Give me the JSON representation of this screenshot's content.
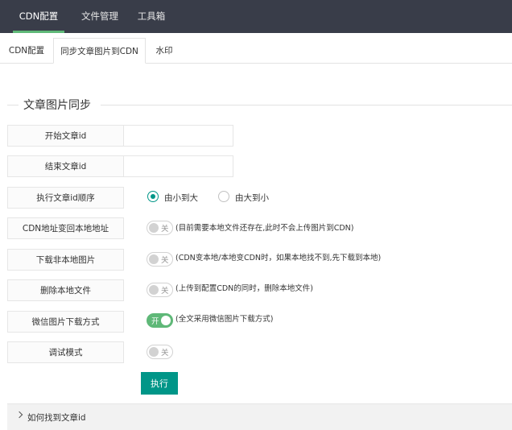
{
  "topnav": {
    "items": [
      {
        "label": "CDN配置",
        "active": true
      },
      {
        "label": "文件管理",
        "active": false
      },
      {
        "label": "工具箱",
        "active": false
      }
    ],
    "accent": "#5fb878",
    "background": "#393d49"
  },
  "tabs": [
    {
      "label": "CDN配置",
      "active": false
    },
    {
      "label": "同步文章图片到CDN",
      "active": true
    },
    {
      "label": "水印",
      "active": false
    }
  ],
  "section": {
    "title": "文章图片同步"
  },
  "form": {
    "start_id": {
      "label": "开始文章id",
      "value": ""
    },
    "end_id": {
      "label": "结束文章id",
      "value": ""
    },
    "order": {
      "label": "执行文章id顺序",
      "options": [
        "由小到大",
        "由大到小"
      ],
      "selected": "由小到大"
    },
    "cdn_restore": {
      "label": "CDN地址变回本地地址",
      "switch_text": "关",
      "on": false,
      "hint": "(目前需要本地文件还存在,此时不会上传图片到CDN)"
    },
    "download_remote": {
      "label": "下载非本地图片",
      "switch_text": "关",
      "on": false,
      "hint": "(CDN变本地/本地变CDN时，如果本地找不到,先下载到本地)"
    },
    "delete_local": {
      "label": "删除本地文件",
      "switch_text": "关",
      "on": false,
      "hint": "(上传到配置CDN的同时，删除本地文件)"
    },
    "wechat_mode": {
      "label": "微信图片下载方式",
      "switch_text": "开",
      "on": true,
      "hint": "(全文采用微信图片下载方式)"
    },
    "debug": {
      "label": "调试模式",
      "switch_text": "关",
      "on": false
    }
  },
  "execute_button": "执行",
  "help": {
    "label": "如何找到文章id"
  },
  "colors": {
    "primary": "#009688",
    "switch_on": "#5fb878"
  }
}
